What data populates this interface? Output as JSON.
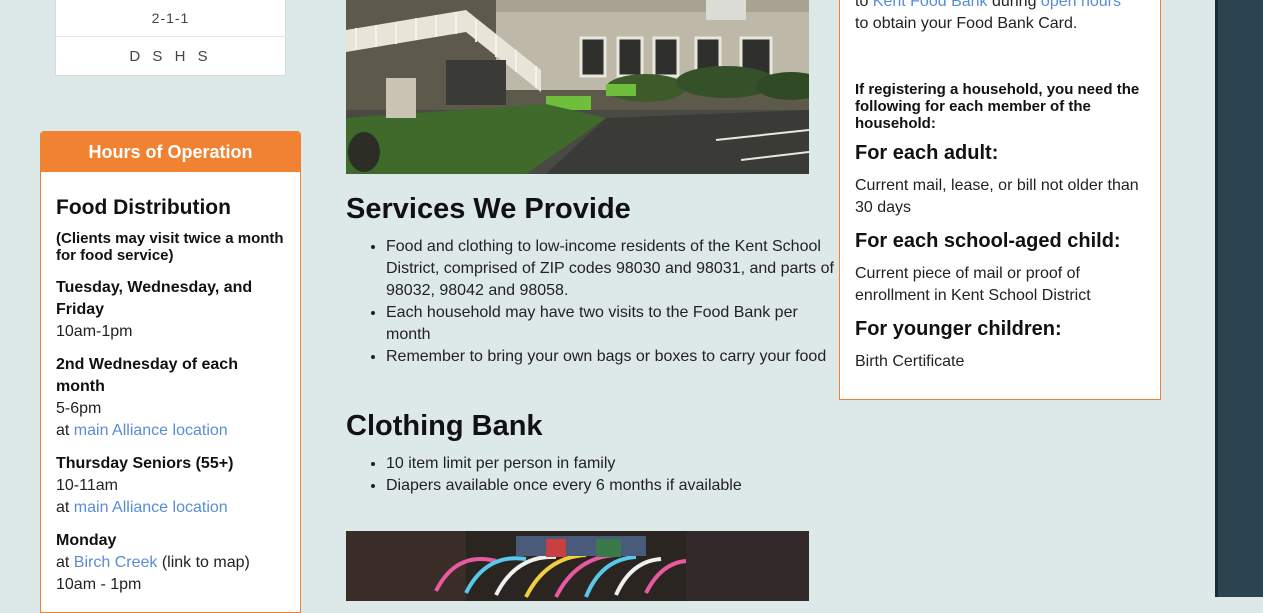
{
  "left_links": [
    "2-1-1",
    "D S H S"
  ],
  "hours": {
    "header": "Hours of Operation",
    "title": "Food Distribution",
    "note": "(Clients may visit twice a month for food service)",
    "slots": [
      {
        "title": "Tuesday, Wednesday, and Friday",
        "time": "10am-1pm",
        "at": "",
        "link": "",
        "after": ""
      },
      {
        "title": "2nd Wednesday of each month",
        "time": "5-6pm",
        "at": "at ",
        "link": "main Alliance location",
        "after": ""
      },
      {
        "title": "Thursday Seniors (55+)",
        "time": "10-11am",
        "at": "at ",
        "link": "main Alliance location",
        "after": ""
      },
      {
        "title": "Monday",
        "time": "10am - 1pm",
        "at": "at ",
        "link": "Birch Creek",
        "after": " (link to map)"
      }
    ]
  },
  "services": {
    "title": "Services We Provide",
    "items": [
      "Food and clothing to low-income residents of the Kent School District, comprised of ZIP codes 98030 and 98031, and parts of 98032, 98042 and 98058.",
      "Each household may have two visits to the Food Bank per month",
      "Remember to bring your own bags or boxes to carry your food"
    ]
  },
  "clothing": {
    "title": "Clothing Bank",
    "items": [
      "10 item limit per person in family",
      "Diapers available once every 6 months if available"
    ]
  },
  "register": {
    "top_prefix": "to ",
    "top_link1": "Kent Food Bank",
    "top_mid": " during ",
    "top_link2": "open hours",
    "top_suffix": "to obtain your Food Bank Card.",
    "need": "If registering a household, you need the following for each member of the household:",
    "adult_title": "For each adult:",
    "adult_text": "Current mail, lease, or bill not older than 30 days",
    "child_title": "For each school-aged child:",
    "child_text": "Current piece of mail or proof of enrollment in Kent School District",
    "young_title": "For younger children:",
    "young_text": "Birth Certificate"
  },
  "colors": {
    "accent": "#f08232",
    "link": "#5a8cd6",
    "page_bg": "#dde8e8",
    "strip": "#2c4450"
  }
}
